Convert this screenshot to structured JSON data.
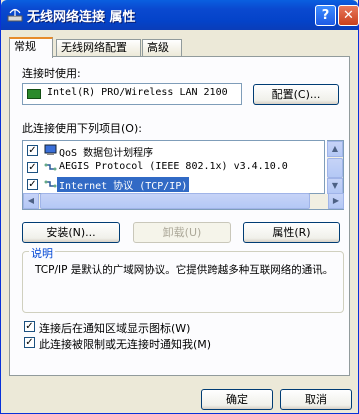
{
  "window": {
    "title": "无线网络连接 属性"
  },
  "tabs": [
    {
      "label": "常规",
      "active": true
    },
    {
      "label": "无线网络配置",
      "active": false
    },
    {
      "label": "高级",
      "active": false
    }
  ],
  "connect_using": {
    "label": "连接时使用:",
    "device": "Intel(R) PRO/Wireless LAN 2100",
    "configure_label": "配置(C)..."
  },
  "items": {
    "label": "此连接使用下列项目(O):",
    "list": [
      {
        "checked": true,
        "icon": "qos-icon",
        "text": "QoS 数据包计划程序",
        "selected": false
      },
      {
        "checked": true,
        "icon": "protocol-icon",
        "text": "AEGIS Protocol (IEEE 802.1x) v3.4.10.0",
        "selected": false
      },
      {
        "checked": true,
        "icon": "protocol-icon",
        "text": "Internet 协议 (TCP/IP)",
        "selected": true
      }
    ]
  },
  "buttons": {
    "install": "安装(N)...",
    "uninstall": "卸载(U)",
    "properties": "属性(R)",
    "ok": "确定",
    "cancel": "取消"
  },
  "description": {
    "title": "说明",
    "text": "TCP/IP 是默认的广域网协议。它提供跨越多种互联网络的通讯。"
  },
  "options": [
    {
      "checked": true,
      "label": "连接后在通知区域显示图标(W)"
    },
    {
      "checked": true,
      "label": "此连接被限制或无连接时通知我(M)"
    }
  ],
  "colors": {
    "title_bar": "#0a49d0",
    "selection": "#316ac5",
    "group_title": "#0046d5"
  }
}
